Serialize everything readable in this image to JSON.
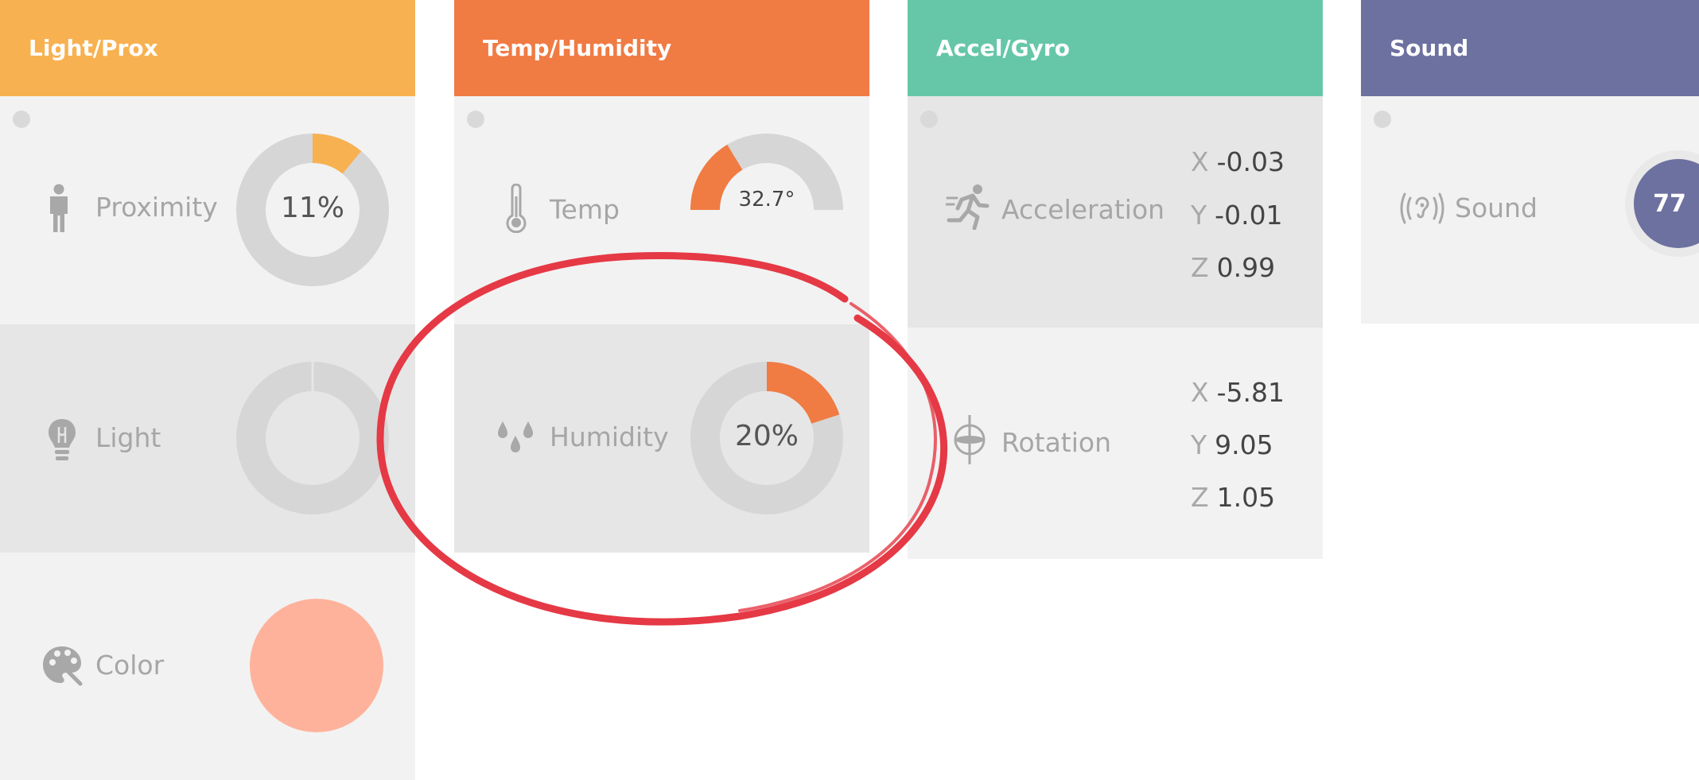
{
  "colors": {
    "light_prox": "#f8b150",
    "temp_humidity": "#f07b43",
    "accel_gyro": "#66c7a8",
    "sound": "#6d71a0",
    "track": "#d6d6d6",
    "color_swatch": "#ffb29b",
    "annotation": "#e53945"
  },
  "panels": {
    "light_prox": {
      "title": "Light/Prox",
      "proximity": {
        "icon": "person-icon",
        "label": "Proximity",
        "value_text": "11%",
        "fraction": 0.11
      },
      "light": {
        "icon": "lightbulb-icon",
        "label": "Light",
        "fraction": 0
      },
      "color": {
        "icon": "palette-icon",
        "label": "Color"
      }
    },
    "temp_humidity": {
      "title": "Temp/Humidity",
      "temp": {
        "icon": "thermometer-icon",
        "label": "Temp",
        "value_text": "32.7°",
        "fraction": 0.327
      },
      "humidity": {
        "icon": "droplets-icon",
        "label": "Humidity",
        "value_text": "20%",
        "fraction": 0.2
      }
    },
    "accel_gyro": {
      "title": "Accel/Gyro",
      "acceleration": {
        "icon": "running-person-icon",
        "label": "Acceleration",
        "axes": [
          {
            "axis": "X",
            "value": "-0.03"
          },
          {
            "axis": "Y",
            "value": "-0.01"
          },
          {
            "axis": "Z",
            "value": "0.99"
          }
        ]
      },
      "rotation": {
        "icon": "gyroscope-icon",
        "label": "Rotation",
        "axes": [
          {
            "axis": "X",
            "value": "-5.81"
          },
          {
            "axis": "Y",
            "value": "9.05"
          },
          {
            "axis": "Z",
            "value": "1.05"
          }
        ]
      }
    },
    "sound": {
      "title": "Sound",
      "sound": {
        "icon": "ear-sound-icon",
        "label": "Sound",
        "value_text": "77"
      }
    }
  }
}
